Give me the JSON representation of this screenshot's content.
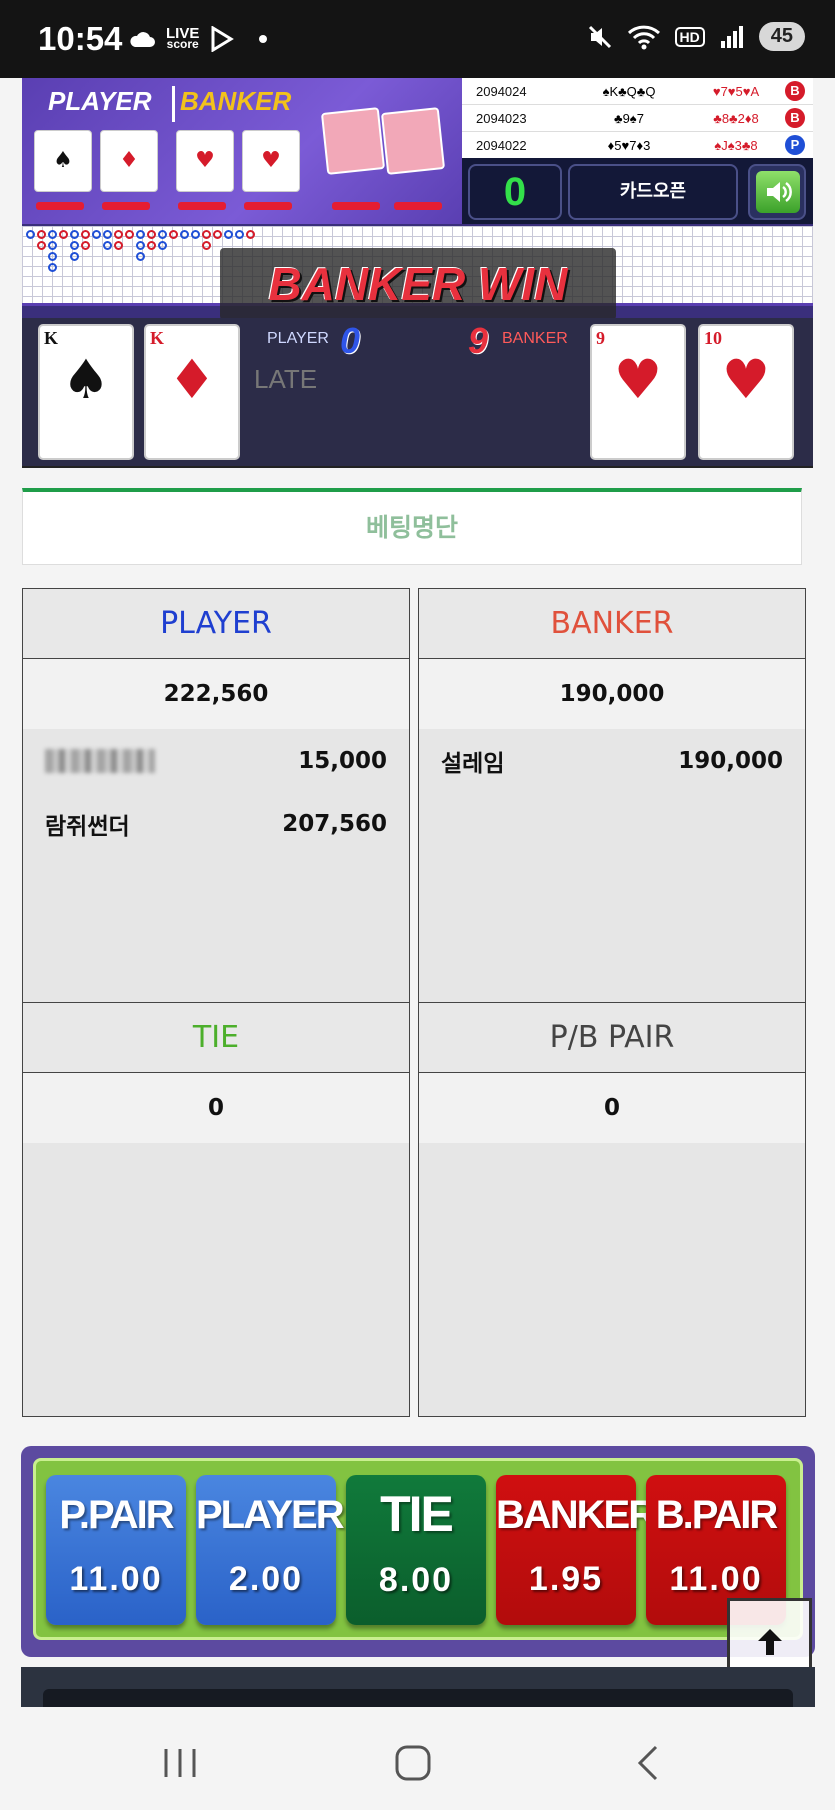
{
  "status_bar": {
    "time": "10:54",
    "live_line1": "LIVE",
    "live_line2": "score",
    "battery": "45",
    "hd": "HD"
  },
  "game": {
    "player_label": "PLAYER",
    "banker_label": "BANKER",
    "history": [
      {
        "id": "2094024",
        "player": "♠K♣Q♣Q",
        "banker": "♥7♥5♥A",
        "result": "B"
      },
      {
        "id": "2094023",
        "player": "♣9♠7",
        "banker": "♣8♣2♦8",
        "result": "B"
      },
      {
        "id": "2094022",
        "player": "♦5♥7♦3",
        "banker": "♠J♠3♣8",
        "result": "P"
      }
    ],
    "counter": "0",
    "card_open": "카드오픈",
    "banner": "BANKER WIN",
    "player_side_label": "PLAYER",
    "player_score": "0",
    "banker_side_label": "BANKER",
    "banker_score": "9",
    "late_text": "LATE",
    "player_cards": [
      {
        "rank": "K",
        "suit": "♠",
        "color": "#111111"
      },
      {
        "rank": "K",
        "suit": "♦",
        "color": "#d51b2a"
      }
    ],
    "banker_cards": [
      {
        "rank": "9",
        "suit": "♥",
        "color": "#d51b2a"
      },
      {
        "rank": "10",
        "suit": "♥",
        "color": "#d51b2a"
      }
    ]
  },
  "betting": {
    "title": "베팅명단",
    "player": {
      "label": "PLAYER",
      "color": "#1f3fd0",
      "total": "222,560",
      "rows": [
        {
          "name": "",
          "amount": "15,000"
        },
        {
          "name": "람쥐썬더",
          "amount": "207,560"
        }
      ]
    },
    "banker": {
      "label": "BANKER",
      "color": "#e0513c",
      "total": "190,000",
      "rows": [
        {
          "name": "설레임",
          "amount": "190,000"
        }
      ]
    },
    "tie": {
      "label": "TIE",
      "color": "#4caf2b",
      "total": "0"
    },
    "pair": {
      "label": "P/B PAIR",
      "color": "#444444",
      "total": "0"
    }
  },
  "odds": [
    {
      "label": "P.PAIR",
      "value": "11.00",
      "style": "blue"
    },
    {
      "label": "PLAYER",
      "value": "2.00",
      "style": "blue"
    },
    {
      "label": "TIE",
      "value": "8.00",
      "style": "green"
    },
    {
      "label": "BANKER",
      "value": "1.95",
      "style": "red"
    },
    {
      "label": "B.PAIR",
      "value": "11.00",
      "style": "red"
    }
  ]
}
